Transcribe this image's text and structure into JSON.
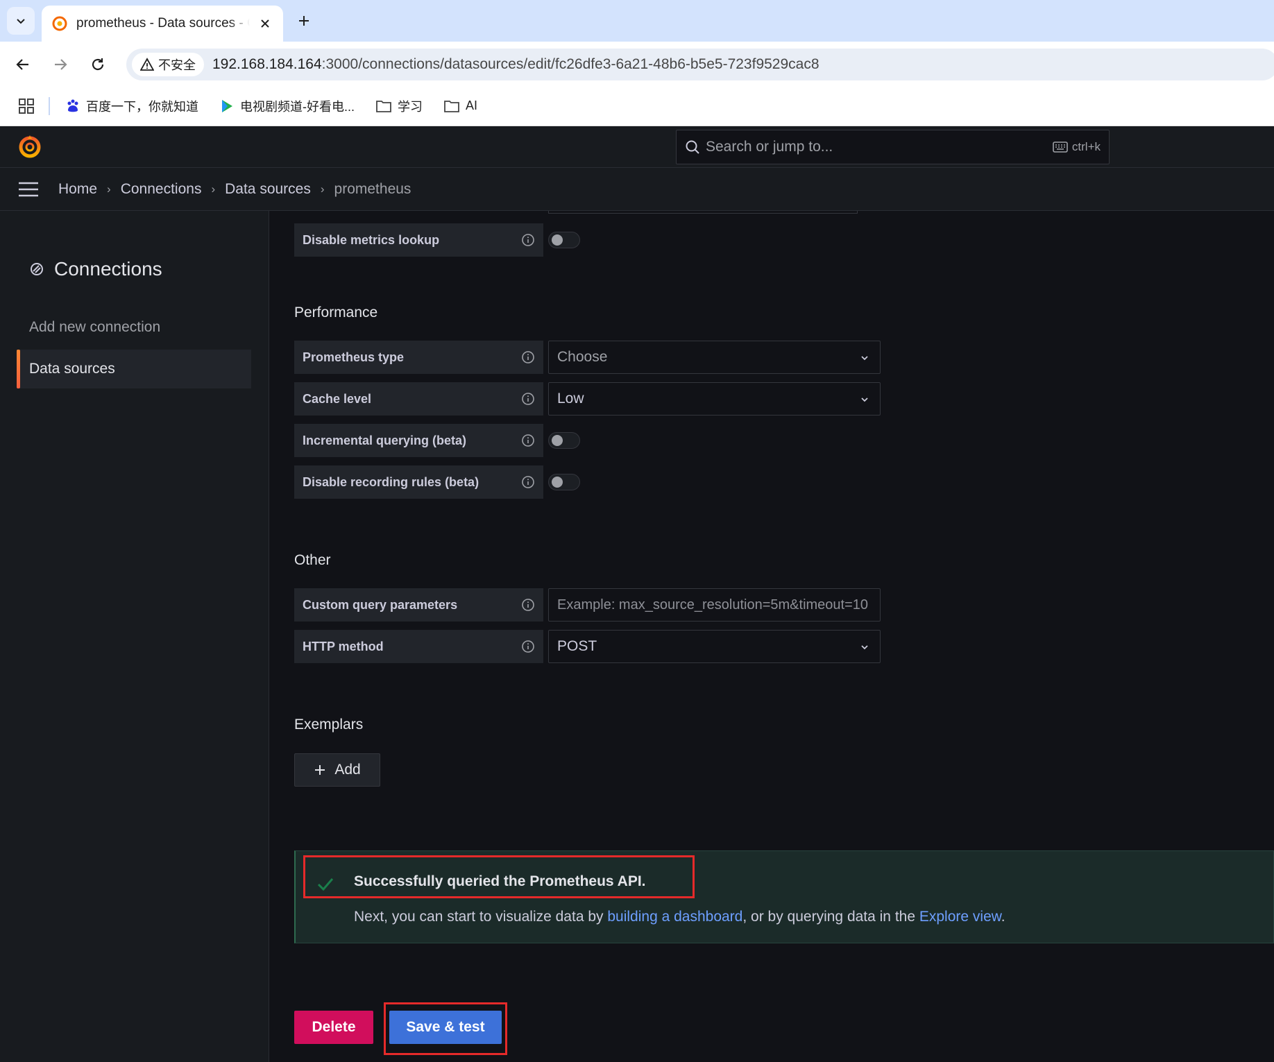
{
  "browser": {
    "tab_title": "prometheus - Data sources - Grafana",
    "url_host": "192.168.184.164",
    "url_rest": ":3000/connections/datasources/edit/fc26dfe3-6a21-48b6-b5e5-723f9529cac8",
    "security_label": "不安全",
    "bookmarks": [
      {
        "label": "百度一下，你就知道",
        "icon": "baidu-icon"
      },
      {
        "label": "电视剧频道-好看电...",
        "icon": "video-icon"
      },
      {
        "label": "学习",
        "icon": "folder-icon"
      },
      {
        "label": "AI",
        "icon": "folder-icon"
      }
    ]
  },
  "grafana": {
    "search_placeholder": "Search or jump to...",
    "search_shortcut": "ctrl+k",
    "breadcrumbs": [
      "Home",
      "Connections",
      "Data sources",
      "prometheus"
    ],
    "sidebar": {
      "title": "Connections",
      "items": [
        "Add new connection",
        "Data sources"
      ]
    },
    "fields": {
      "disable_metrics_lookup": "Disable metrics lookup",
      "performance_title": "Performance",
      "prometheus_type": "Prometheus type",
      "prometheus_type_value": "Choose",
      "cache_level": "Cache level",
      "cache_level_value": "Low",
      "incremental_querying": "Incremental querying (beta)",
      "disable_recording_rules": "Disable recording rules (beta)",
      "other_title": "Other",
      "custom_query_params": "Custom query parameters",
      "custom_query_params_placeholder": "Example: max_source_resolution=5m&timeout=10",
      "http_method": "HTTP method",
      "http_method_value": "POST",
      "exemplars_title": "Exemplars",
      "add_label": "Add"
    },
    "alert": {
      "title": "Successfully queried the Prometheus API.",
      "body_prefix": "Next, you can start to visualize data by ",
      "link1": "building a dashboard",
      "body_mid": ", or by querying data in the ",
      "link2": "Explore view",
      "body_suffix": "."
    },
    "buttons": {
      "delete": "Delete",
      "save_test": "Save & test"
    },
    "colors": {
      "accent_orange": "#f55f3e",
      "primary_blue": "#3d71d9",
      "destructive": "#d10e5c",
      "success": "#1a7f4b",
      "annotation_red": "#e52a2a"
    }
  }
}
